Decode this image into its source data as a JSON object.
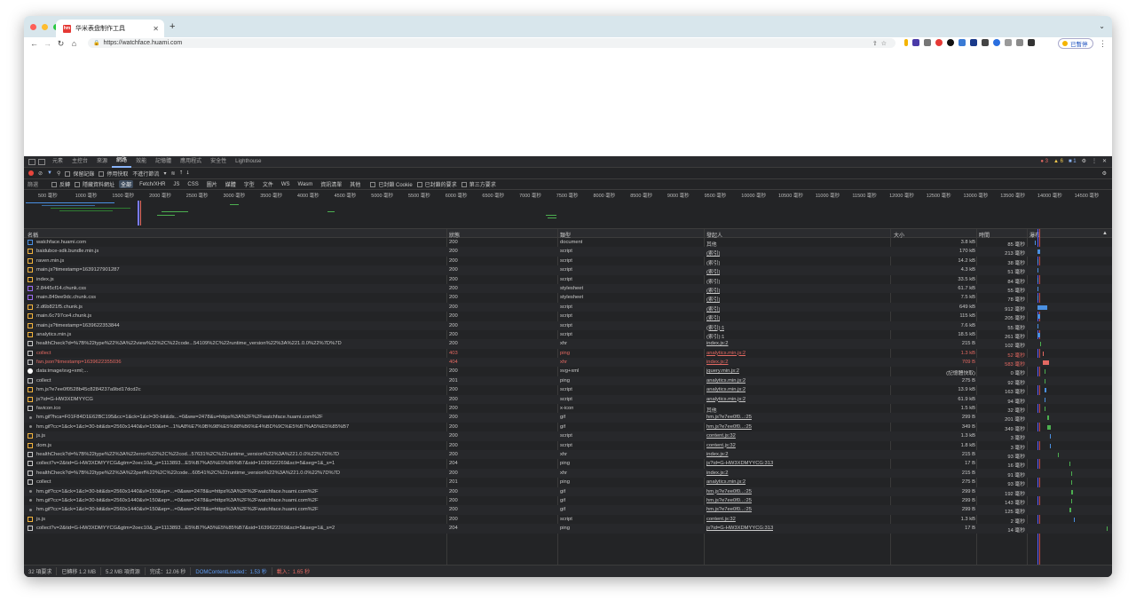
{
  "browser": {
    "tab_title": "华米表盘制作工具",
    "favicon_text": "hm",
    "url": "https://watchface.huami.com",
    "profile_label": "已暫停"
  },
  "devtools": {
    "tabs": [
      "元素",
      "主控台",
      "來源",
      "網路",
      "效能",
      "記憶體",
      "應用程式",
      "安全性",
      "Lighthouse"
    ],
    "active_tab": "網路",
    "errors": "3",
    "warnings": "6",
    "messages": "1",
    "toolbar": {
      "preserve_log": "保留記錄",
      "disable_cache": "停用快取",
      "throttle": "不進行節流"
    },
    "filter": {
      "label": "篩選",
      "invert": "反轉",
      "hide_data_urls": "隱藏資料網址",
      "types": [
        "全部",
        "Fetch/XHR",
        "JS",
        "CSS",
        "圖片",
        "媒體",
        "字型",
        "文件",
        "WS",
        "Wasm",
        "資訊清單",
        "其他"
      ],
      "blocked_cookies": "已封鎖 Cookie",
      "blocked_requests": "已封鎖的要求",
      "third_party": "第三方要求"
    },
    "timeline_ticks": [
      "500 毫秒",
      "1000 毫秒",
      "1500 毫秒",
      "2000 毫秒",
      "2500 毫秒",
      "3000 毫秒",
      "3500 毫秒",
      "4000 毫秒",
      "4500 毫秒",
      "5000 毫秒",
      "5500 毫秒",
      "6000 毫秒",
      "6500 毫秒",
      "7000 毫秒",
      "7500 毫秒",
      "8000 毫秒",
      "8500 毫秒",
      "9000 毫秒",
      "9500 毫秒",
      "10000 毫秒",
      "10500 毫秒",
      "11000 毫秒",
      "11500 毫秒",
      "12000 毫秒",
      "12500 毫秒",
      "13000 毫秒",
      "13500 毫秒",
      "14000 毫秒",
      "14500 毫秒"
    ],
    "columns": {
      "name": "名稱",
      "status": "狀態",
      "type": "類型",
      "initiator": "發起人",
      "size": "大小",
      "time": "時間",
      "waterfall": "瀑布"
    },
    "rows": [
      {
        "name": "watchface.huami.com",
        "status": "200",
        "type": "document",
        "initiator": "其他",
        "size": "3.8 kB",
        "time": "85 毫秒",
        "kind": "doc",
        "wf": 0.4
      },
      {
        "name": "baidubce-sdk.bundle.min.js",
        "status": "200",
        "type": "script",
        "initiator": "(索引)",
        "size": "170 kB",
        "time": "213 毫秒",
        "kind": "js",
        "wf": 0.6
      },
      {
        "name": "raven.min.js",
        "status": "200",
        "type": "script",
        "initiator": "(索引)",
        "size": "14.2 kB",
        "time": "38 毫秒",
        "kind": "js",
        "wf": 0.6
      },
      {
        "name": "main.js?timestamp=1639127901287",
        "status": "200",
        "type": "script",
        "initiator": "(索引)",
        "size": "4.3 kB",
        "time": "51 毫秒",
        "kind": "js",
        "wf": 0.6
      },
      {
        "name": "index.js",
        "status": "200",
        "type": "script",
        "initiator": "(索引)",
        "size": "33.5 kB",
        "time": "84 毫秒",
        "kind": "js",
        "wf": 0.6
      },
      {
        "name": "2.8445cf14.chunk.css",
        "status": "200",
        "type": "stylesheet",
        "initiator": "(索引)",
        "size": "61.7 kB",
        "time": "55 毫秒",
        "kind": "css",
        "wf": 0.6
      },
      {
        "name": "main.849ee9dc.chunk.css",
        "status": "200",
        "type": "stylesheet",
        "initiator": "(索引)",
        "size": "7.5 kB",
        "time": "78 毫秒",
        "kind": "css",
        "wf": 0.6
      },
      {
        "name": "2.d6b821f5.chunk.js",
        "status": "200",
        "type": "script",
        "initiator": "(索引)",
        "size": "649 kB",
        "time": "912 毫秒",
        "kind": "js",
        "wf": 0.6
      },
      {
        "name": "main.6c797ce4.chunk.js",
        "status": "200",
        "type": "script",
        "initiator": "(索引)",
        "size": "115 kB",
        "time": "205 毫秒",
        "kind": "js",
        "wf": 0.6
      },
      {
        "name": "main.js?timestamp=1639622353844",
        "status": "200",
        "type": "script",
        "initiator": "(索引):1",
        "size": "7.6 kB",
        "time": "55 毫秒",
        "kind": "js",
        "wf": 0.6
      },
      {
        "name": "analytics.min.js",
        "status": "200",
        "type": "script",
        "initiator": "(索引):1",
        "size": "18.5 kB",
        "time": "261 毫秒",
        "kind": "js",
        "wf": 0.6
      },
      {
        "name": "healthCheck?d=%7B%22type%22%3A%22view%22%2C%22code...54109%2C%22runtime_version%22%3A%221.0.0%22%7D%7D",
        "status": "200",
        "type": "xhr",
        "initiator": "index.js:2",
        "size": "215 B",
        "time": "102 毫秒",
        "kind": "xhr",
        "wf": 0.8
      },
      {
        "name": "collect",
        "status": "403",
        "type": "ping",
        "initiator": "analytics.min.js:2",
        "size": "1.3 kB",
        "time": "52 毫秒",
        "kind": "blank",
        "error": true,
        "wf": 1.0
      },
      {
        "name": "fan.json?timestamp=1639622355036",
        "status": "404",
        "type": "xhr",
        "initiator": "index.js:2",
        "size": "709 B",
        "time": "583 毫秒",
        "kind": "xhr",
        "error": true,
        "wf": 1.0
      },
      {
        "name": "data:image/svg+xml;...",
        "status": "200",
        "type": "svg+xml",
        "initiator": "jquery.min.js:2",
        "size": "(記憶體快取)",
        "time": "0 毫秒",
        "kind": "img",
        "wf": 1.1
      },
      {
        "name": "collect",
        "status": "201",
        "type": "ping",
        "initiator": "analytics.min.js:2",
        "size": "275 B",
        "time": "92 毫秒",
        "kind": "blank",
        "wf": 1.1
      },
      {
        "name": "hm.js?e7ee0f0528b45c8284237a9bd17dcd2c",
        "status": "200",
        "type": "script",
        "initiator": "analytics.min.js:2",
        "size": "13.9 kB",
        "time": "163 毫秒",
        "kind": "js",
        "wf": 1.1
      },
      {
        "name": "js?id=G-HW3XDMYYCG",
        "status": "200",
        "type": "script",
        "initiator": "analytics.min.js:2",
        "size": "61.9 kB",
        "time": "94 毫秒",
        "kind": "js",
        "wf": 1.1
      },
      {
        "name": "favicon.ico",
        "status": "200",
        "type": "x-icon",
        "initiator": "其他",
        "size": "1.5 kB",
        "time": "32 毫秒",
        "kind": "blank",
        "wf": 1.1
      },
      {
        "name": "hm.gif?hca=F01F84D1E62BC195&cc=1&ck=1&cl=30-bit&ds...=0&ww=2478&u=https%3A%2F%2Fwatchface.huami.com%2F",
        "status": "200",
        "type": "gif",
        "initiator": "hm.js?e7ee0f0...:25",
        "size": "299 B",
        "time": "201 毫秒",
        "kind": "dot",
        "wf": 1.3
      },
      {
        "name": "hm.gif?cc=1&ck=1&cl=30-bit&ds=2560x1440&vl=150&et=...1%A8%E7%9B%98%E5%88%B6%E4%BD%9C%E5%B7%A5%E5%85%B7",
        "status": "200",
        "type": "gif",
        "initiator": "hm.js?e7ee0f0...:25",
        "size": "349 B",
        "time": "349 毫秒",
        "kind": "dot",
        "wf": 1.3
      },
      {
        "name": "js.js",
        "status": "200",
        "type": "script",
        "initiator": "content.js:32",
        "size": "1.3 kB",
        "time": "3 毫秒",
        "kind": "js",
        "wf": 1.5
      },
      {
        "name": "dom.js",
        "status": "200",
        "type": "script",
        "initiator": "content.js:32",
        "size": "1.8 kB",
        "time": "3 毫秒",
        "kind": "js",
        "wf": 1.5
      },
      {
        "name": "healthCheck?d=%7B%22type%22%3A%22error%22%2C%22cod...57631%2C%22runtime_version%22%3A%221.0.0%22%7D%7D",
        "status": "200",
        "type": "xhr",
        "initiator": "index.js:2",
        "size": "215 B",
        "time": "93 毫秒",
        "kind": "xhr",
        "wf": 2.1
      },
      {
        "name": "collect?v=2&tid=G-HW3XDMYYCG&gtm=2oec10&_p=1113893...E5%B7%A5%E5%85%B7&sid=1639622269&sct=5&seg=1&_s=1",
        "status": "204",
        "type": "ping",
        "initiator": "js?id=G-HW3XDMYYCG:313",
        "size": "17 B",
        "time": "16 毫秒",
        "kind": "blank",
        "wf": 3.0
      },
      {
        "name": "healthCheck?d=%7B%22type%22%3A%22perf%22%2C%22code...60541%2C%22runtime_version%22%3A%221.0.0%22%7D%7D",
        "status": "200",
        "type": "xhr",
        "initiator": "index.js:2",
        "size": "215 B",
        "time": "91 毫秒",
        "kind": "xhr",
        "wf": 3.1
      },
      {
        "name": "collect",
        "status": "201",
        "type": "ping",
        "initiator": "analytics.min.js:2",
        "size": "275 B",
        "time": "93 毫秒",
        "kind": "blank",
        "wf": 3.1
      },
      {
        "name": "hm.gif?cc=1&ck=1&cl=30-bit&ds=2560x1440&vl=150&ep=...=0&ww=2478&u=https%3A%2F%2Fwatchface.huami.com%2F",
        "status": "200",
        "type": "gif",
        "initiator": "hm.js?e7ee0f0...:25",
        "size": "299 B",
        "time": "192 毫秒",
        "kind": "dot",
        "wf": 3.1
      },
      {
        "name": "hm.gif?cc=1&ck=1&cl=30-bit&ds=2560x1440&vl=150&ep=...=0&ww=2478&u=https%3A%2F%2Fwatchface.huami.com%2F",
        "status": "200",
        "type": "gif",
        "initiator": "hm.js?e7ee0f0...:25",
        "size": "299 B",
        "time": "143 毫秒",
        "kind": "dot",
        "wf": 3.1
      },
      {
        "name": "hm.gif?cc=1&ck=1&cl=30-bit&ds=2560x1440&vl=150&ep=...=0&ww=2478&u=https%3A%2F%2Fwatchface.huami.com%2F",
        "status": "200",
        "type": "gif",
        "initiator": "hm.js?e7ee0f0...:25",
        "size": "299 B",
        "time": "125 毫秒",
        "kind": "dot",
        "wf": 3.0
      },
      {
        "name": "js.js",
        "status": "200",
        "type": "script",
        "initiator": "content.js:32",
        "size": "1.3 kB",
        "time": "2 毫秒",
        "kind": "js",
        "wf": 3.3
      },
      {
        "name": "collect?v=2&tid=G-HW3XDMYYCG&gtm=2oec10&_p=1113893...E5%B7%A5%E5%85%B7&sid=1639622269&sct=5&seg=1&_s=2",
        "status": "204",
        "type": "ping",
        "initiator": "js?id=G-HW3XDMYYCG:313",
        "size": "17 B",
        "time": "14 毫秒",
        "kind": "blank",
        "wf": 5.8
      }
    ],
    "status": {
      "requests": "32 項要求",
      "transferred": "已轉移 1.2 MB",
      "resources": "5.2 MB 項資源",
      "finish": "完成：12.06 秒",
      "dcl": "DOMContentLoaded：1.53 秒",
      "load": "載入：1.65 秒"
    }
  }
}
